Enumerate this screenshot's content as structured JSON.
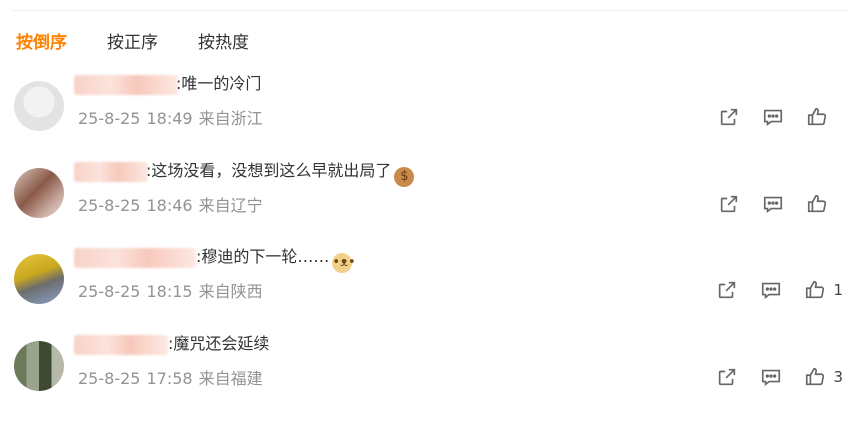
{
  "sort_tabs": [
    {
      "label": "按倒序",
      "active": true
    },
    {
      "label": "按正序",
      "active": false
    },
    {
      "label": "按热度",
      "active": false
    }
  ],
  "comments": [
    {
      "text": ":唯一的冷门",
      "date": "25-8-25",
      "time": "18:49",
      "location": "来自浙江",
      "likes": "",
      "emoji": ""
    },
    {
      "text": ":这场没看，没想到这么早就出局了",
      "date": "25-8-25",
      "time": "18:46",
      "location": "来自辽宁",
      "likes": "",
      "emoji": "moneybag-emoji"
    },
    {
      "text": ":穆迪的下一轮……",
      "date": "25-8-25",
      "time": "18:15",
      "location": "来自陕西",
      "likes": "1",
      "emoji": "doge-emoji"
    },
    {
      "text": ":魔咒还会延续",
      "date": "25-8-25",
      "time": "17:58",
      "location": "来自福建",
      "likes": "3",
      "emoji": ""
    }
  ],
  "colors": {
    "accent": "#ff8200",
    "meta": "#939393"
  },
  "icons": [
    "share-icon",
    "comment-icon",
    "like-icon"
  ]
}
